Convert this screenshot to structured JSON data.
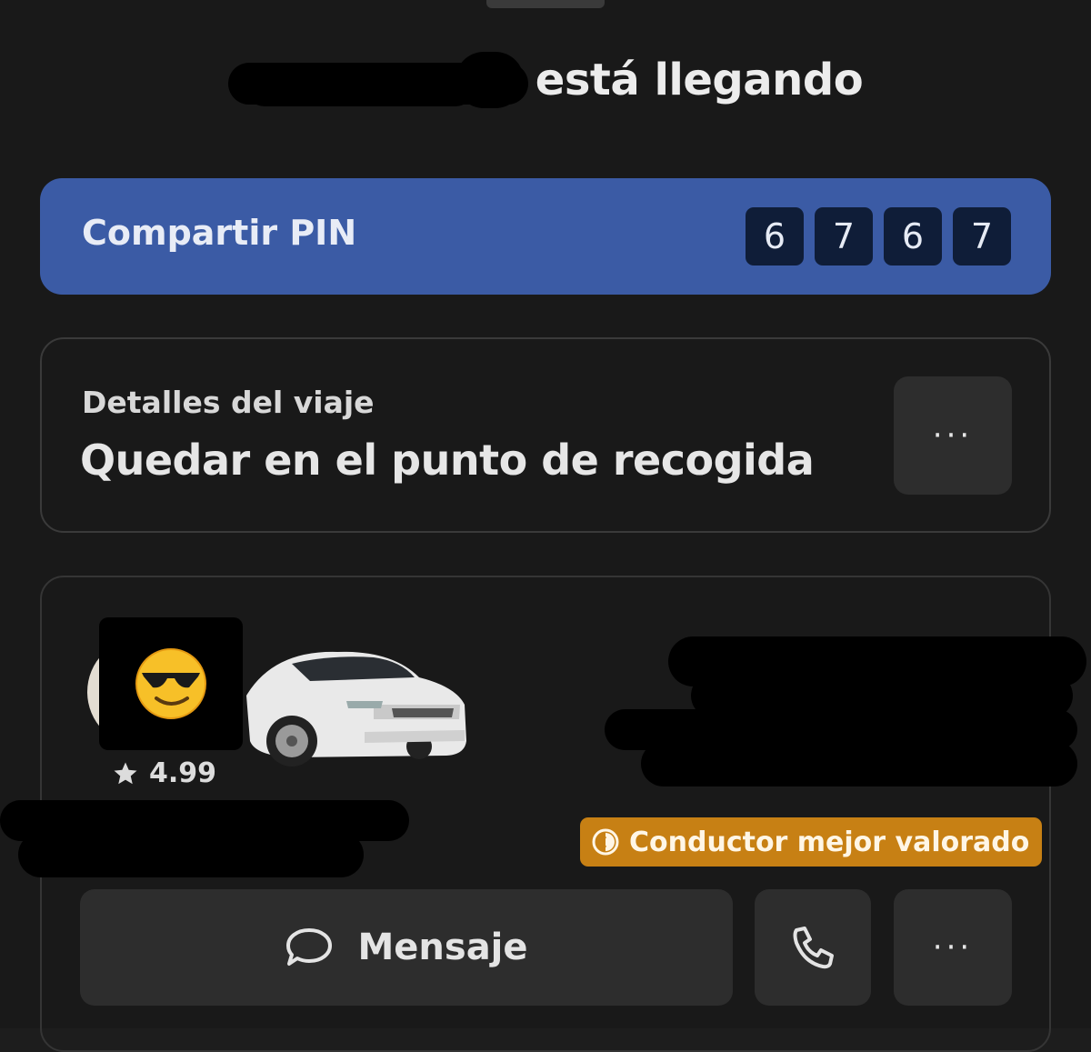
{
  "header": {
    "title_suffix": "está llegando"
  },
  "pin": {
    "label": "Compartir PIN",
    "digits": [
      "6",
      "7",
      "6",
      "7"
    ]
  },
  "trip": {
    "subtitle": "Detalles del viaje",
    "title": "Quedar en el punto de recogida",
    "more_label": "···"
  },
  "driver": {
    "rating": "4.99",
    "badge": "Conductor mejor valorado",
    "message_label": "Mensaje",
    "more_label": "···"
  },
  "colors": {
    "pin_card": "#3b5ba5",
    "pin_digit_bg": "#0f1d38",
    "badge": "#c78014",
    "background": "#191919"
  },
  "icons": [
    "star-icon",
    "badge-icon",
    "message-icon",
    "phone-icon",
    "more-icon"
  ]
}
